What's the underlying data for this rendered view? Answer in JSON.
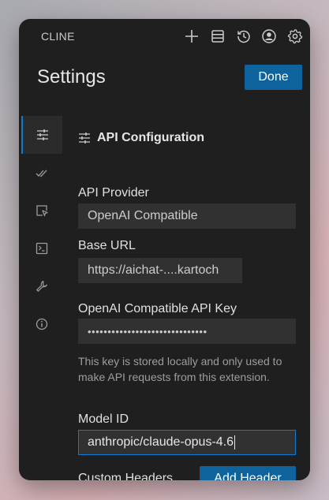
{
  "app": {
    "name": "CLINE"
  },
  "header": {
    "title": "Settings",
    "done_label": "Done"
  },
  "toolbar": {
    "icons": [
      "plus-icon",
      "database-icon",
      "history-icon",
      "account-icon",
      "gear-icon"
    ]
  },
  "sidebar": {
    "items": [
      {
        "icon": "sliders-icon",
        "active": true
      },
      {
        "icon": "check-all-icon",
        "active": false
      },
      {
        "icon": "browser-icon",
        "active": false
      },
      {
        "icon": "terminal-icon",
        "active": false
      },
      {
        "icon": "wrench-icon",
        "active": false
      },
      {
        "icon": "info-icon",
        "active": false
      }
    ]
  },
  "api": {
    "section_title": "API Configuration",
    "provider_label": "API Provider",
    "provider_value": "OpenAI Compatible",
    "base_url_label": "Base URL",
    "base_url_value": "https://aichat-....kartoch",
    "api_key_label": "OpenAI Compatible API Key",
    "api_key_value": "••••••••••••••••••••••••••••••",
    "api_key_help": "This key is stored locally and only used to make API requests from this extension.",
    "model_id_label": "Model ID",
    "model_id_value": "anthropic/claude-opus-4.6",
    "custom_headers_label": "Custom Headers",
    "add_header_label": "Add Header"
  },
  "colors": {
    "accent": "#0e639c",
    "focus_border": "#0e7ad1",
    "panel_bg": "#1f1f1f",
    "input_bg": "#313131"
  }
}
